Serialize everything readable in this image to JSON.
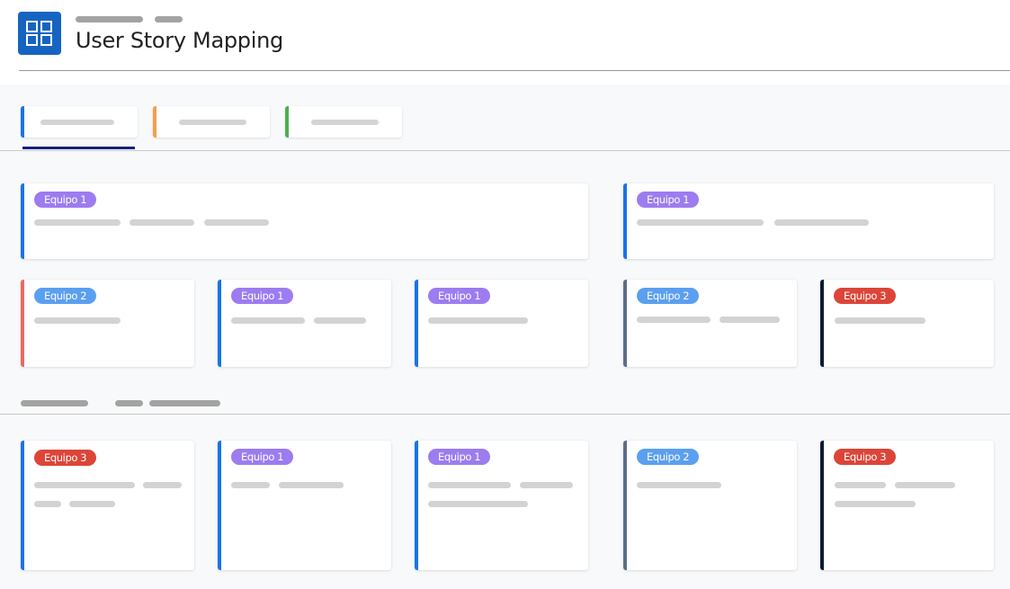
{
  "header": {
    "title": "User Story Mapping",
    "app_icon": "grid-icon",
    "brand_color": "#1565c0"
  },
  "tabs": [
    {
      "label": "",
      "accent": "#1a73e8",
      "active": true
    },
    {
      "label": "",
      "accent": "#f2a049"
    },
    {
      "label": "",
      "accent": "#4caf50"
    }
  ],
  "teams": {
    "team1": {
      "label": "Equipo 1",
      "color": "#9c7cf0"
    },
    "team2": {
      "label": "Equipo 2",
      "color": "#5b9ff0"
    },
    "team3": {
      "label": "Equipo 3",
      "color": "#dc4538"
    }
  },
  "epics": [
    {
      "team_label": "Equipo 1",
      "accent": "#1a73e8"
    },
    {
      "team_label": "Equipo 1",
      "accent": "#1a73e8"
    }
  ],
  "stories_row1": [
    {
      "team_label": "Equipo 2",
      "accent": "#ea6b60"
    },
    {
      "team_label": "Equipo 1",
      "accent": "#1a73e8"
    },
    {
      "team_label": "Equipo 1",
      "accent": "#1a73e8"
    },
    {
      "team_label": "Equipo 2",
      "accent": "#5c6e85"
    },
    {
      "team_label": "Equipo 3",
      "accent": "#0d1b33"
    }
  ],
  "stories_row2": [
    {
      "team_label": "Equipo 3",
      "accent": "#1a73e8"
    },
    {
      "team_label": "Equipo 1",
      "accent": "#1a73e8"
    },
    {
      "team_label": "Equipo 1",
      "accent": "#1a73e8"
    },
    {
      "team_label": "Equipo 2",
      "accent": "#5c6e85"
    },
    {
      "team_label": "Equipo 3",
      "accent": "#0d1b33"
    }
  ]
}
